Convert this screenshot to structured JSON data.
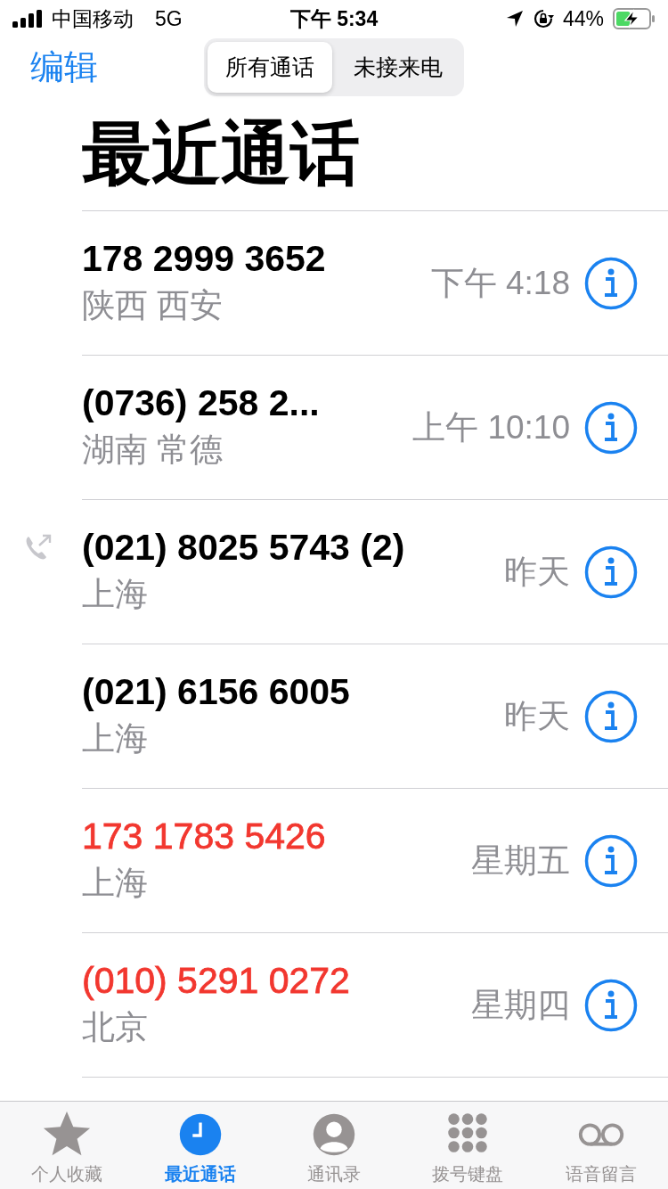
{
  "status_bar": {
    "carrier": "中国移动",
    "network": "5G",
    "time": "下午 5:34",
    "battery": "44%"
  },
  "nav": {
    "edit": "编辑",
    "segments": [
      {
        "label": "所有通话",
        "selected": true
      },
      {
        "label": "未接来电",
        "selected": false
      }
    ]
  },
  "title": "最近通话",
  "calls": [
    {
      "number": "178 2999 3652",
      "location": "陕西 西安",
      "time": "下午 4:18",
      "missed": false,
      "outgoing": false
    },
    {
      "number": "(0736) 258 2...",
      "location": "湖南 常德",
      "time": "上午 10:10",
      "missed": false,
      "outgoing": false
    },
    {
      "number": "(021) 8025 5743 (2)",
      "location": "上海",
      "time": "昨天",
      "missed": false,
      "outgoing": true
    },
    {
      "number": "(021) 6156 6005",
      "location": "上海",
      "time": "昨天",
      "missed": false,
      "outgoing": false
    },
    {
      "number": "173 1783 5426",
      "location": "上海",
      "time": "星期五",
      "missed": true,
      "outgoing": false
    },
    {
      "number": "(010) 5291 0272",
      "location": "北京",
      "time": "星期四",
      "missed": true,
      "outgoing": false
    }
  ],
  "tab_bar": [
    {
      "kind": "favorites",
      "label": "个人收藏",
      "selected": false
    },
    {
      "kind": "recents",
      "label": "最近通话",
      "selected": true
    },
    {
      "kind": "contacts",
      "label": "通讯录",
      "selected": false
    },
    {
      "kind": "keypad",
      "label": "拨号键盘",
      "selected": false
    },
    {
      "kind": "voicemail",
      "label": "语音留言",
      "selected": false
    }
  ]
}
